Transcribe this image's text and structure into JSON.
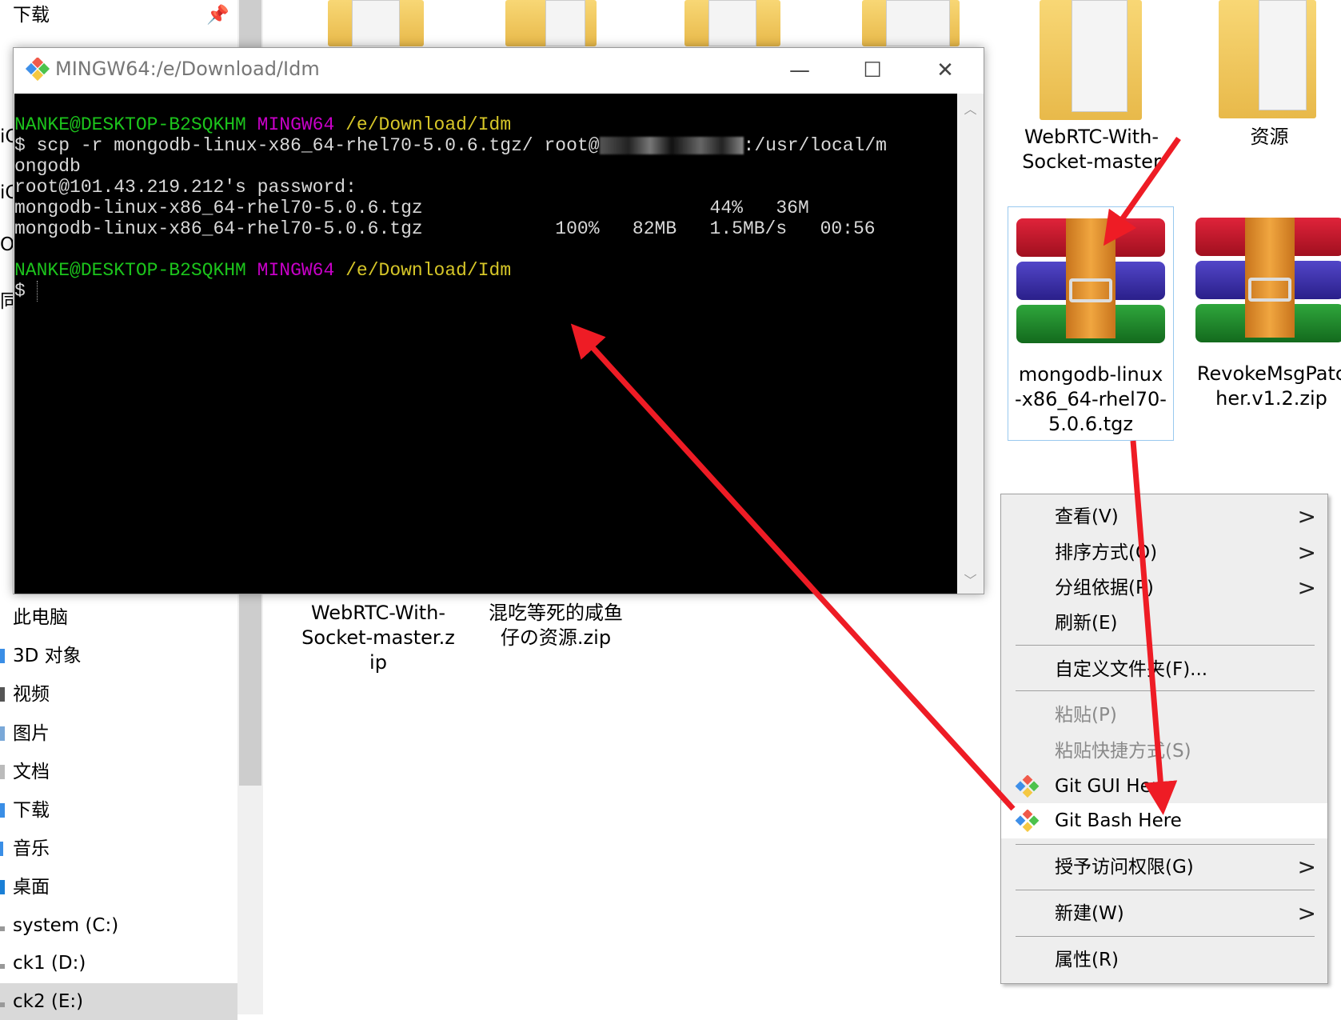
{
  "sidebar": {
    "top_item": "下载",
    "items": [
      {
        "label": "此电脑"
      },
      {
        "label": "3D 对象"
      },
      {
        "label": "视频"
      },
      {
        "label": "图片"
      },
      {
        "label": "文档"
      },
      {
        "label": "下载"
      },
      {
        "label": "音乐"
      },
      {
        "label": "桌面"
      },
      {
        "label": "system (C:)"
      },
      {
        "label": "ck1 (D:)"
      },
      {
        "label": "ck2 (E:)"
      }
    ]
  },
  "files": {
    "folder1": "WebRTC-With-\nSocket-master",
    "folder1_l1": "WebRTC-With-",
    "folder1_l2": "Socket-master",
    "folder2": "资源",
    "selected_l1": "mongodb-linux",
    "selected_l2": "-x86_64-rhel70-",
    "selected_l3": "5.0.6.tgz",
    "revoke_l1": "RevokeMsgPatc",
    "revoke_l2": "her.v1.2.zip",
    "webrtc_zip_l1": "WebRTC-With-",
    "webrtc_zip_l2": "Socket-master.z",
    "webrtc_zip_l3": "ip",
    "fish_l1": "混吃等死的咸鱼",
    "fish_l2": "仔の资源.zip"
  },
  "terminal": {
    "title": "MINGW64:/e/Download/Idm",
    "user_host": "NANKE@DESKTOP-B2SQKHM",
    "env": "MINGW64",
    "cwd": "/e/Download/Idm",
    "cmd_pre": "$ scp -r mongodb-linux-x86_64-rhel70-5.0.6.tgz/ root@",
    "cmd_post": ":/usr/local/m",
    "cmd_wrap": "ongodb",
    "password_prompt": "root@101.43.219.212's password:",
    "progress1": "mongodb-linux-x86_64-rhel70-5.0.6.tgz                          44%   36M",
    "progress2": "mongodb-linux-x86_64-rhel70-5.0.6.tgz            100%   82MB   1.5MB/s   00:56",
    "prompt": "$ "
  },
  "menu": {
    "items": [
      {
        "label": "查看(V)"
      },
      {
        "label": "排序方式(O)"
      },
      {
        "label": "分组依据(P)"
      },
      {
        "label": "刷新(E)"
      },
      {
        "label": "自定义文件夹(F)..."
      },
      {
        "label": "粘贴(P)"
      },
      {
        "label": "粘贴快捷方式(S)"
      },
      {
        "label": "Git GUI Here"
      },
      {
        "label": "Git Bash Here"
      },
      {
        "label": "授予访问权限(G)"
      },
      {
        "label": "新建(W)"
      },
      {
        "label": "属性(R)"
      }
    ],
    "submenu_arrow": ">"
  },
  "colors": {
    "arrow": "#ee1c25",
    "green": "#1cc41c",
    "magenta": "#c800c8",
    "yellow": "#d6c628"
  }
}
